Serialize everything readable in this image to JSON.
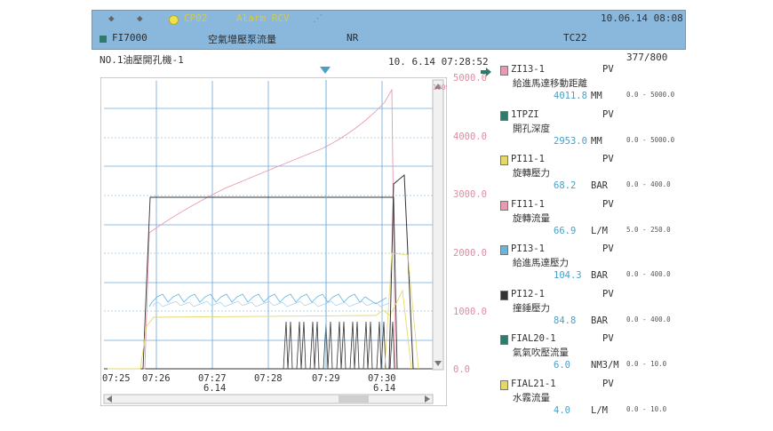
{
  "header": {
    "cp_label": "CP02",
    "alarm_label": "Alarm RCV",
    "datetime": "10.06.14 08:08",
    "tag": "FI7000",
    "tag_desc": "空氣增壓泵流量",
    "mode": "NR",
    "tc": "TC22"
  },
  "subheader": {
    "machine": "NO.1油壓開孔機-1",
    "cursor_time": "10. 6.14 07:28:52",
    "page_count": "377/800"
  },
  "colors": {
    "titlebar": "#8ab7dc",
    "grid": "#6fa6d6",
    "pink": "#e79ab0",
    "blue": "#6cb3dc",
    "yellow": "#e3d86a",
    "dark": "#333333",
    "teal": "#2f7a6b"
  },
  "chart_data": {
    "type": "line",
    "x_labels": [
      "07:25",
      "07:26",
      "07:27",
      "07:28",
      "07:29",
      "07:30"
    ],
    "x_date_labels": [
      "6.14",
      "6.14"
    ],
    "y_axis_labels": [
      "5000.0",
      "4000.0",
      "3000.0",
      "2000.0",
      "1000.0",
      "0.0"
    ],
    "ylim": [
      0,
      5000
    ],
    "axis_unit": "100%",
    "grid": true
  },
  "legend": [
    {
      "num": "1",
      "tag": "ZI13-1",
      "pv": "PV",
      "desc": "給進馬達移動距離",
      "value": "4011.8",
      "unit": "MM",
      "range": "0.0 - 5000.0",
      "color": "#e79ab0"
    },
    {
      "num": "2",
      "tag": "1TPZI",
      "pv": "PV",
      "desc": "開孔深度",
      "value": "2953.0",
      "unit": "MM",
      "range": "0.0 - 5000.0",
      "color": "#2f7a6b"
    },
    {
      "num": "3",
      "tag": "PI11-1",
      "pv": "PV",
      "desc": "旋轉壓力",
      "value": "68.2",
      "unit": "BAR",
      "range": "0.0 - 400.0",
      "color": "#e3d86a"
    },
    {
      "num": "4",
      "tag": "FI11-1",
      "pv": "PV",
      "desc": "旋轉流量",
      "value": "66.9",
      "unit": "L/M",
      "range": "5.0 - 250.0",
      "color": "#e79ab0"
    },
    {
      "num": "5",
      "tag": "PI13-1",
      "pv": "PV",
      "desc": "給進馬達壓力",
      "value": "104.3",
      "unit": "BAR",
      "range": "0.0 - 400.0",
      "color": "#6cb3dc"
    },
    {
      "num": "6",
      "tag": "PI12-1",
      "pv": "PV",
      "desc": "撞錘壓力",
      "value": "84.8",
      "unit": "BAR",
      "range": "0.0 - 400.0",
      "color": "#333333"
    },
    {
      "num": "7",
      "tag": "FIAL20-1",
      "pv": "PV",
      "desc": "氣氣吹壓流量",
      "value": "6.0",
      "unit": "NM3/M",
      "range": "0.0 - 10.0",
      "color": "#2f7a6b"
    },
    {
      "num": "8",
      "tag": "FIAL21-1",
      "pv": "PV",
      "desc": "水霧流量",
      "value": "4.0",
      "unit": "L/M",
      "range": "0.0 - 10.0",
      "color": "#e3d86a"
    }
  ]
}
